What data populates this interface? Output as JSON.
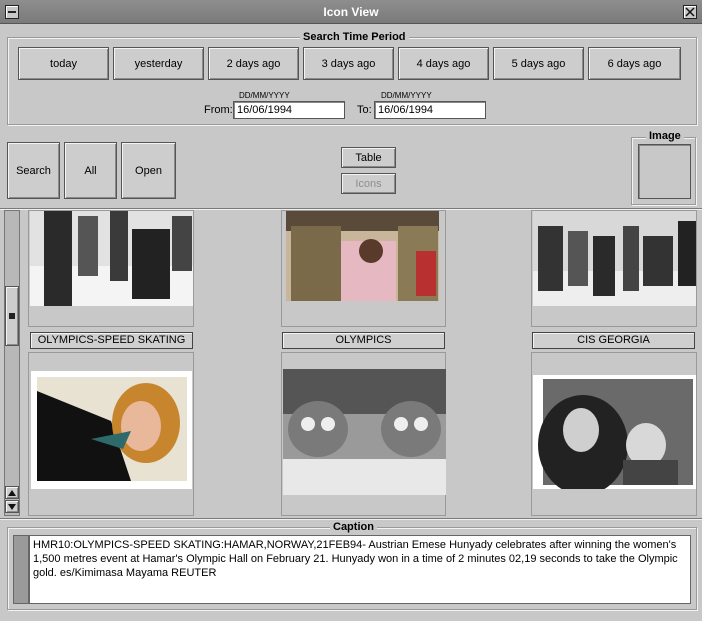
{
  "window": {
    "title": "Icon View"
  },
  "search_period": {
    "legend": "Search Time Period",
    "buttons": [
      "today",
      "yesterday",
      "2 days ago",
      "3 days ago",
      "4 days ago",
      "5 days ago",
      "6 days ago"
    ],
    "from": {
      "label": "From:",
      "format": "DD/MM/YYYY",
      "value": "16/06/1994"
    },
    "to": {
      "label": "To:",
      "format": "DD/MM/YYYY",
      "value": "16/06/1994"
    }
  },
  "actions": {
    "search": "Search",
    "all": "All",
    "open": "Open",
    "table": "Table",
    "icons": "Icons"
  },
  "image_preview": {
    "legend": "Image"
  },
  "thumbnails": {
    "labels": [
      "OLYMPICS-SPEED SKATING",
      "OLYMPICS",
      "CIS GEORGIA"
    ]
  },
  "caption": {
    "legend": "Caption",
    "text": "HMR10:OLYMPICS-SPEED SKATING:HAMAR,NORWAY,21FEB94- Austrian Emese Hunyady celebrates after winning the  women's 1,500 metres event at Hamar's Olympic Hall on February 21. Hunyady won in a time of 2 minutes 02,19 seconds to take the Olympic gold.   es/Kimimasa Mayama    REUTER"
  },
  "colors": {
    "window_bg": "#c8c8c8",
    "titlebar": "#7f7f7f"
  }
}
